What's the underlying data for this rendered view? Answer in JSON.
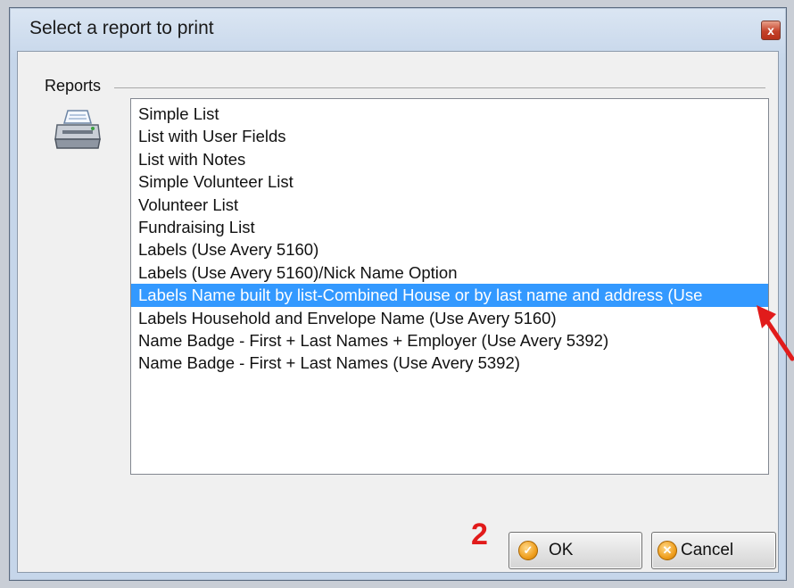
{
  "dialog": {
    "title": "Select a report to print",
    "close_label": "x"
  },
  "group": {
    "label": "Reports"
  },
  "reports": [
    "Simple List",
    "List with User Fields",
    "List with Notes",
    "Simple Volunteer List",
    "Volunteer List",
    "Fundraising List",
    "Labels (Use Avery 5160)",
    "Labels (Use Avery 5160)/Nick Name Option",
    "Labels Name built by list-Combined House or by last name and address (Use",
    "Labels Household and Envelope Name (Use Avery 5160)",
    "Name Badge - First + Last Names + Employer (Use Avery 5392)",
    "Name Badge - First + Last Names (Use Avery 5392)"
  ],
  "selected_index": 8,
  "buttons": {
    "ok_label": "OK",
    "cancel_label": "Cancel"
  },
  "annotation": {
    "number": "2",
    "color": "#e11b1b"
  },
  "colors": {
    "selection": "#3399ff"
  },
  "icons": {
    "printer": "printer-icon",
    "ok": "ok-check-icon",
    "cancel": "cancel-x-icon",
    "arrow": "red-arrow-icon"
  }
}
